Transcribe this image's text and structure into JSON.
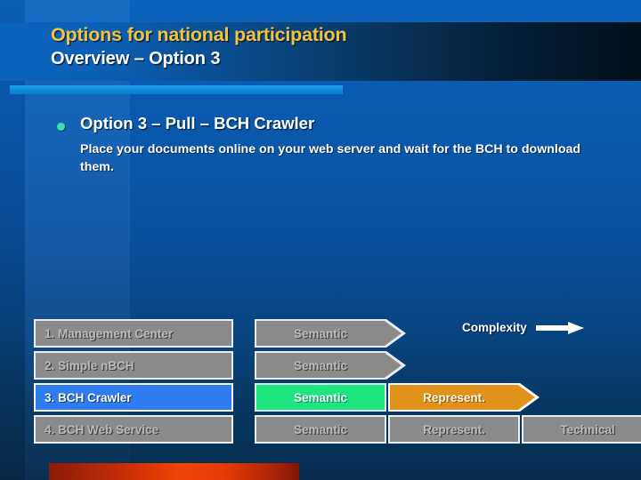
{
  "slide": {
    "title_line1": "Options for national participation",
    "title_line2": "Overview – Option 3",
    "accent_color": "#0d8ddc",
    "title_color": "#f2c33c",
    "subtitle_color": "#ffffff"
  },
  "bullet": {
    "heading": "Option 3 – Pull – BCH Crawler",
    "body": "Place your documents online on your web server and wait for the BCH to download them.",
    "marker_color": "#3ce0b0"
  },
  "legend": {
    "complexity_label": "Complexity",
    "arrow_color": "#ffffff"
  },
  "matrix": {
    "rows": [
      {
        "label": "1. Management Center",
        "highlighted": false,
        "cells": [
          {
            "text": "Semantic",
            "style": "grey",
            "shape": "chevron"
          }
        ]
      },
      {
        "label": "2. Simple nBCH",
        "highlighted": false,
        "cells": [
          {
            "text": "Semantic",
            "style": "grey",
            "shape": "chevron"
          }
        ]
      },
      {
        "label": "3. BCH Crawler",
        "highlighted": true,
        "cells": [
          {
            "text": "Semantic",
            "style": "green",
            "shape": "rect"
          },
          {
            "text": "Represent.",
            "style": "orange",
            "shape": "chevron"
          }
        ]
      },
      {
        "label": "4. BCH Web Service",
        "highlighted": false,
        "cells": [
          {
            "text": "Semantic",
            "style": "grey",
            "shape": "rect"
          },
          {
            "text": "Represent.",
            "style": "grey",
            "shape": "rect"
          },
          {
            "text": "Technical",
            "style": "grey",
            "shape": "chevron"
          }
        ]
      }
    ],
    "colors": {
      "grey": "#8a8a8a",
      "green": "#1fe57f",
      "orange": "#e0921a",
      "highlight_blue": "#2f7cf0"
    }
  },
  "footer": {
    "bar_color": "#f04305"
  }
}
